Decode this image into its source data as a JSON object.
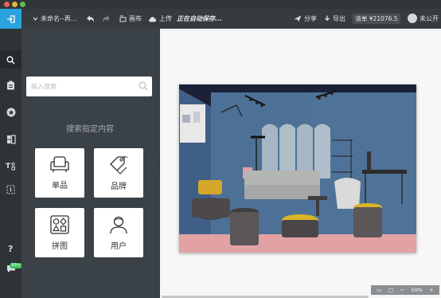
{
  "toolbar": {
    "filename": "未命名--再...",
    "canvas_label": "画布",
    "upload_label": "上传",
    "saving_status": "正在自动保存...",
    "share_label": "分享",
    "export_label": "导出",
    "price_label": "清单 ¥21076.5",
    "visibility_label": "未公开"
  },
  "sidebar": {
    "icons": [
      "search-icon",
      "clipboard-icon",
      "star-icon",
      "furniture-icon",
      "text-style-icon",
      "crop-icon",
      "help-icon",
      "chat-icon"
    ],
    "badge": "99+"
  },
  "panel": {
    "search_placeholder": "输入搜索",
    "heading": "搜索指定内容",
    "cards": [
      {
        "label": "单品",
        "icon": "armchair-icon"
      },
      {
        "label": "品牌",
        "icon": "tag-icon"
      },
      {
        "label": "拼图",
        "icon": "shapes-icon"
      },
      {
        "label": "用户",
        "icon": "user-icon"
      }
    ]
  },
  "canvas": {
    "zoom_level": "50%",
    "zoom_out": "−",
    "zoom_in": "+"
  },
  "colors": {
    "accent": "#2aa3df",
    "toolbar": "#363b40",
    "panel": "#3b4247",
    "room_wall": "#4a6c8f",
    "room_floor": "#e3a4a4"
  }
}
